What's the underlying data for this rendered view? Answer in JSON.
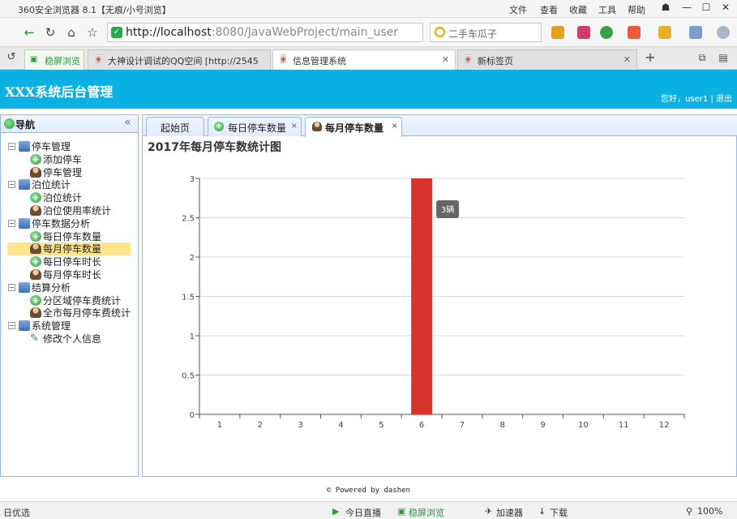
{
  "browser": {
    "title": "360安全浏览器 8.1【无痕/小号浏览】",
    "menu": [
      "文件",
      "查看",
      "收藏",
      "工具",
      "帮助"
    ],
    "url_host": "http://localhost",
    "url_rest": ":8080/JavaWebProject/main_user",
    "search_placeholder": "二手车瓜子",
    "tabs": [
      {
        "label": "稳屏浏览"
      },
      {
        "label": "大神设计调试的QQ空间 [http://2545"
      },
      {
        "label": "信息管理系统"
      },
      {
        "label": "新标签页"
      }
    ],
    "new_tab": "+"
  },
  "app": {
    "title": "XXX系统后台管理",
    "user_text": "您好，user1 | 退出"
  },
  "sidebar": {
    "title": "导航",
    "collapse": "«",
    "groups": [
      {
        "label": "停车管理",
        "items": [
          {
            "label": "添加停车",
            "icon": "plus-icon"
          },
          {
            "label": "停车管理",
            "icon": "user-icon"
          }
        ]
      },
      {
        "label": "泊位统计",
        "items": [
          {
            "label": "泊位统计",
            "icon": "plus-icon"
          },
          {
            "label": "泊位使用率统计",
            "icon": "user-icon"
          }
        ]
      },
      {
        "label": "停车数据分析",
        "items": [
          {
            "label": "每日停车数量",
            "icon": "plus-icon"
          },
          {
            "label": "每月停车数量",
            "icon": "user-icon",
            "selected": true
          },
          {
            "label": "每日停车时长",
            "icon": "plus-icon"
          },
          {
            "label": "每月停车时长",
            "icon": "user-icon"
          }
        ]
      },
      {
        "label": "结算分析",
        "items": [
          {
            "label": "分区域停车费统计",
            "icon": "plus-icon"
          },
          {
            "label": "全市每月停车费统计",
            "icon": "user-icon"
          }
        ]
      },
      {
        "label": "系统管理",
        "items": [
          {
            "label": "修改个人信息",
            "icon": "pencil-icon"
          }
        ]
      }
    ]
  },
  "content_tabs": [
    {
      "label": "起始页"
    },
    {
      "label": "每日停车数量"
    },
    {
      "label": "每月停车数量"
    }
  ],
  "chart_data": {
    "type": "bar",
    "title": "2017年每月停车数统计图",
    "categories": [
      "1",
      "2",
      "3",
      "4",
      "5",
      "6",
      "7",
      "8",
      "9",
      "10",
      "11",
      "12"
    ],
    "values": [
      0,
      0,
      0,
      0,
      0,
      3,
      0,
      0,
      0,
      0,
      0,
      0
    ],
    "ylim": [
      0,
      3
    ],
    "yticks": [
      0,
      0.5,
      1,
      1.5,
      2,
      2.5,
      3
    ],
    "grid": true,
    "bar_color": "#d9342b",
    "tooltip": "3辆"
  },
  "footer": "© Powered by dashen",
  "statusbar": {
    "left": "日优选",
    "items": [
      "今日直播",
      "稳屏浏览",
      "加速器",
      "下载"
    ],
    "zoom": "100%"
  }
}
